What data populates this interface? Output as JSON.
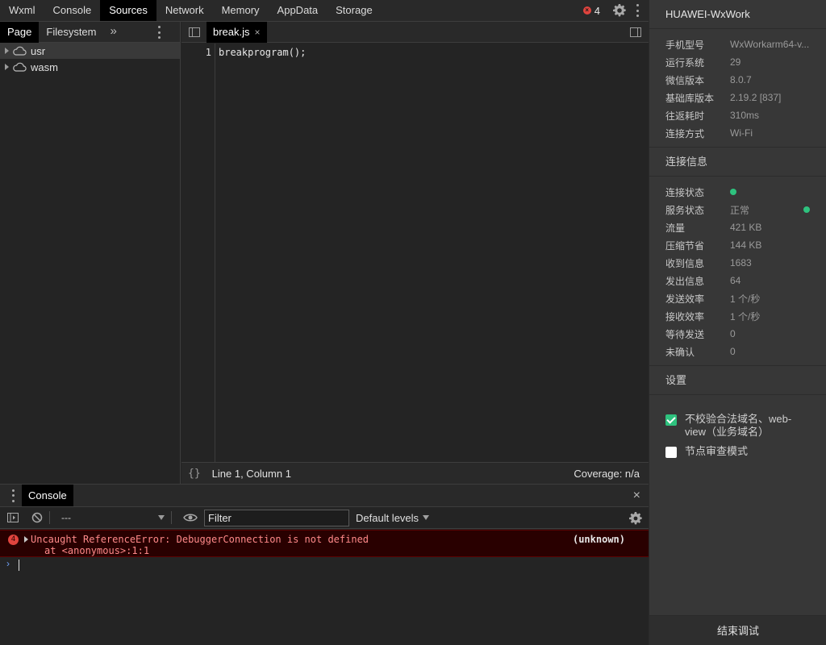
{
  "main_tabs": [
    "Wxml",
    "Console",
    "Sources",
    "Network",
    "Memory",
    "AppData",
    "Storage"
  ],
  "active_main_tab": "Sources",
  "error_count": "4",
  "navigator": {
    "tabs": [
      "Page",
      "Filesystem"
    ],
    "more": "»",
    "tree": [
      {
        "label": "usr",
        "selected": true
      },
      {
        "label": "wasm",
        "selected": false
      }
    ]
  },
  "editor": {
    "file_tab": "break.js",
    "close_glyph": "×",
    "line_numbers": [
      "1"
    ],
    "code_lines": [
      "breakprogram();"
    ],
    "status": {
      "braces": "{}",
      "position": "Line 1, Column 1",
      "coverage": "Coverage: n/a"
    }
  },
  "drawer": {
    "tab": "Console",
    "close_glyph": "×",
    "context": "---",
    "filter_placeholder": "Filter",
    "levels": "Default levels",
    "error": {
      "count": "4",
      "line1": "Uncaught ReferenceError: DebuggerConnection is not defined",
      "line2": "at <anonymous>:1:1",
      "source": "(unknown)"
    },
    "prompt": "›"
  },
  "info_panel": {
    "device_title": "HUAWEI-WxWork",
    "device_info": [
      {
        "k": "手机型号",
        "v": "WxWorkarm64-v..."
      },
      {
        "k": "运行系统",
        "v": "29"
      },
      {
        "k": "微信版本",
        "v": "8.0.7"
      },
      {
        "k": "基础库版本",
        "v": "2.19.2 [837]"
      },
      {
        "k": "往返耗时",
        "v": "310ms"
      },
      {
        "k": "连接方式",
        "v": "Wi-Fi"
      }
    ],
    "connection_title": "连接信息",
    "connection_info": [
      {
        "k": "连接状态",
        "v": "",
        "dot": true
      },
      {
        "k": "服务状态",
        "v": "正常",
        "right_dot": true
      },
      {
        "k": "流量",
        "v": "421 KB"
      },
      {
        "k": "压缩节省",
        "v": "144 KB"
      },
      {
        "k": "收到信息",
        "v": "1683"
      },
      {
        "k": "发出信息",
        "v": "64"
      },
      {
        "k": "发送效率",
        "v": "1 个/秒"
      },
      {
        "k": "接收效率",
        "v": "1 个/秒"
      },
      {
        "k": "等待发送",
        "v": "0"
      },
      {
        "k": "未确认",
        "v": "0"
      }
    ],
    "settings_title": "设置",
    "settings": [
      {
        "label": "不校验合法域名、web-view（业务域名）",
        "checked": true
      },
      {
        "label": "节点审查模式",
        "checked": false
      }
    ],
    "end_button": "结束调试"
  },
  "colors": {
    "accent_green": "#2ec27e",
    "error_red": "#e0443e",
    "error_bg": "#290000"
  }
}
